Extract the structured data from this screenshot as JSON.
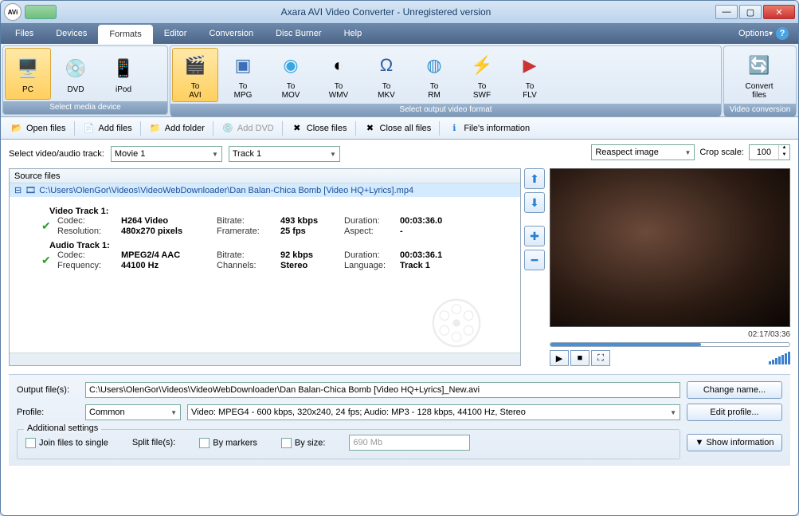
{
  "window": {
    "title": "Axara AVI Video Converter - Unregistered version"
  },
  "menus": {
    "files": "Files",
    "devices": "Devices",
    "formats": "Formats",
    "editor": "Editor",
    "conversion": "Conversion",
    "discburner": "Disc Burner",
    "help": "Help",
    "options": "Options"
  },
  "ribbon": {
    "group1_label": "Select media device",
    "group2_label": "Select output video format",
    "group3_label": "Video conversion",
    "devices": {
      "pc": "PC",
      "dvd": "DVD",
      "ipod": "iPod"
    },
    "formats": {
      "avi": "To\nAVI",
      "mpg": "To\nMPG",
      "mov": "To\nMOV",
      "wmv": "To\nWMV",
      "mkv": "To\nMKV",
      "rm": "To\nRM",
      "swf": "To\nSWF",
      "flv": "To\nFLV"
    },
    "convert": "Convert\nfiles"
  },
  "toolbar": {
    "open": "Open files",
    "add": "Add files",
    "addfolder": "Add folder",
    "adddvd": "Add DVD",
    "close": "Close files",
    "closeall": "Close all files",
    "info": "File's information"
  },
  "track_sel": {
    "label": "Select video/audio track:",
    "movie": "Movie 1",
    "track": "Track 1"
  },
  "source": {
    "header": "Source files",
    "path": "C:\\Users\\OlenGor\\Videos\\VideoWebDownloader\\Dan Balan-Chica Bomb [Video HQ+Lyrics].mp4",
    "video_title": "Video Track 1:",
    "v_codec_k": "Codec:",
    "v_codec_v": "H264 Video",
    "v_res_k": "Resolution:",
    "v_res_v": "480x270 pixels",
    "v_br_k": "Bitrate:",
    "v_br_v": "493 kbps",
    "v_fr_k": "Framerate:",
    "v_fr_v": "25 fps",
    "v_dur_k": "Duration:",
    "v_dur_v": "00:03:36.0",
    "v_asp_k": "Aspect:",
    "v_asp_v": "-",
    "audio_title": "Audio Track 1:",
    "a_codec_k": "Codec:",
    "a_codec_v": "MPEG2/4 AAC",
    "a_freq_k": "Frequency:",
    "a_freq_v": "44100 Hz",
    "a_br_k": "Bitrate:",
    "a_br_v": "92 kbps",
    "a_ch_k": "Channels:",
    "a_ch_v": "Stereo",
    "a_dur_k": "Duration:",
    "a_dur_v": "00:03:36.1",
    "a_lang_k": "Language:",
    "a_lang_v": "Track 1"
  },
  "preview": {
    "mode": "Reaspect image",
    "crop_label": "Crop scale:",
    "crop_value": "100",
    "time": "02:17/03:36"
  },
  "output": {
    "file_label": "Output file(s):",
    "file_value": "C:\\Users\\OlenGor\\Videos\\VideoWebDownloader\\Dan Balan-Chica Bomb [Video HQ+Lyrics]_New.avi",
    "profile_label": "Profile:",
    "profile_name": "Common",
    "profile_desc": "Video: MPEG4 - 600 kbps, 320x240, 24 fps; Audio: MP3 - 128 kbps, 44100 Hz, Stereo",
    "change_name": "Change name...",
    "edit_profile": "Edit profile..."
  },
  "additional": {
    "legend": "Additional settings",
    "join": "Join files to single",
    "split_label": "Split file(s):",
    "by_markers": "By markers",
    "by_size": "By size:",
    "size_value": "690 Mb",
    "show_info": "Show information"
  }
}
